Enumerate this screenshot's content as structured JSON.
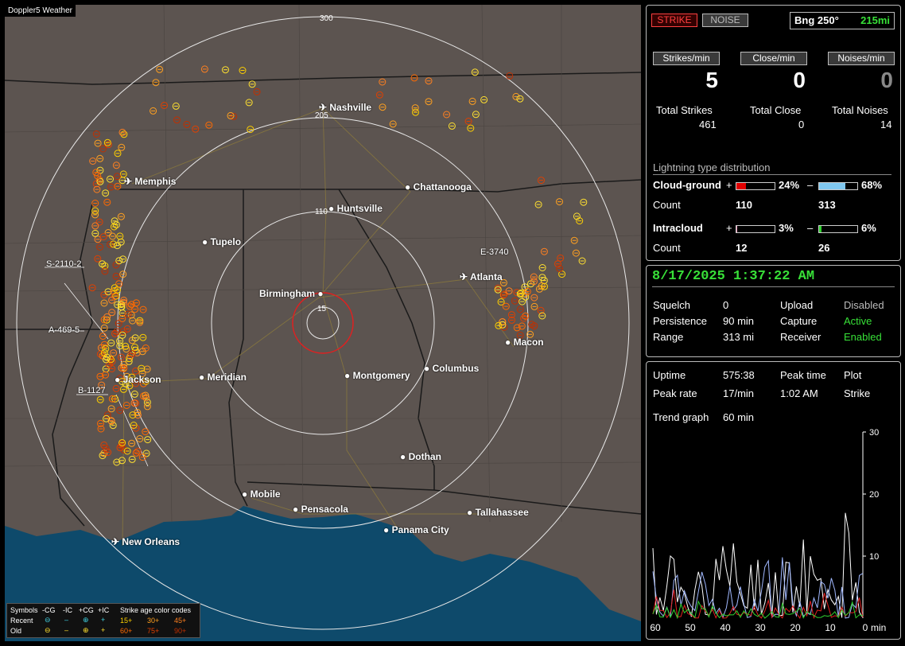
{
  "app_title": "Doppler5 Weather",
  "map": {
    "cities": [
      {
        "name": "Nashville",
        "airport": true
      },
      {
        "name": "Memphis",
        "airport": true
      },
      {
        "name": "Chattanooga",
        "airport": false
      },
      {
        "name": "Huntsville",
        "airport": false
      },
      {
        "name": "Tupelo",
        "airport": false
      },
      {
        "name": "Atlanta",
        "airport": true
      },
      {
        "name": "Birmingham",
        "airport": false
      },
      {
        "name": "Macon",
        "airport": false
      },
      {
        "name": "Jackson",
        "airport": true
      },
      {
        "name": "Meridian",
        "airport": false
      },
      {
        "name": "Montgomery",
        "airport": false
      },
      {
        "name": "Columbus",
        "airport": false
      },
      {
        "name": "Dothan",
        "airport": false
      },
      {
        "name": "Mobile",
        "airport": false
      },
      {
        "name": "Pensacola",
        "airport": false
      },
      {
        "name": "Tallahassee",
        "airport": false
      },
      {
        "name": "Panama City",
        "airport": false
      },
      {
        "name": "New Orleans",
        "airport": true
      }
    ],
    "range_labels": [
      "300",
      "205",
      "110",
      "15"
    ],
    "storm_labels": [
      "S-2110-2",
      "A-469-5",
      "B-1127",
      "E-3740"
    ]
  },
  "legend": {
    "symbols_title": "Symbols",
    "cg_neg": "-CG",
    "ic_neg": "-IC",
    "cg_pos": "+CG",
    "ic_pos": "+IC",
    "age_title": "Strike age color codes",
    "recent": "Recent",
    "old": "Old",
    "ages": [
      "15+",
      "30+",
      "45+",
      "60+",
      "75+",
      "90+"
    ],
    "age_colors": [
      "#ffd000",
      "#ffa020",
      "#ff8020",
      "#ff6a00",
      "#e04000",
      "#c03000"
    ]
  },
  "panel1": {
    "strike_btn": "STRIKE",
    "noise_btn": "NOISE",
    "bearing": "Bng 250°",
    "distance": "215mi",
    "hdr_strikes": "Strikes/min",
    "hdr_close": "Close/min",
    "hdr_noises": "Noises/min",
    "val_strikes": "5",
    "val_close": "0",
    "val_noises": "0",
    "lbl_total_strikes": "Total Strikes",
    "lbl_total_close": "Total Close",
    "lbl_total_noises": "Total Noises",
    "total_strikes": "461",
    "total_close": "0",
    "total_noises": "14",
    "dist_title": "Lightning type distribution",
    "cg_label": "Cloud-ground",
    "cg_plus": "+",
    "cg_plus_pct": "24%",
    "cg_minus": "–",
    "cg_minus_pct": "68%",
    "count_label": "Count",
    "cg_plus_count": "110",
    "cg_minus_count": "313",
    "ic_label": "Intracloud",
    "ic_plus": "+",
    "ic_plus_pct": "3%",
    "ic_minus": "–",
    "ic_minus_pct": "6%",
    "ic_plus_count": "12",
    "ic_minus_count": "26",
    "cg_plus_level": 24,
    "cg_minus_level": 68,
    "ic_plus_level": 3,
    "ic_minus_level": 6
  },
  "panel2": {
    "datetime": "8/17/2025 1:37:22 AM",
    "squelch_label": "Squelch",
    "squelch": "0",
    "upload_label": "Upload",
    "upload": "Disabled",
    "persistence_label": "Persistence",
    "persistence": "90 min",
    "capture_label": "Capture",
    "capture": "Active",
    "range_label": "Range",
    "range": "313 mi",
    "receiver_label": "Receiver",
    "receiver": "Enabled"
  },
  "panel3": {
    "uptime_label": "Uptime",
    "uptime": "575:38",
    "peak_time_label": "Peak time",
    "plot_label": "Plot",
    "peak_rate_label": "Peak rate",
    "peak_rate": "17/min",
    "peak_time": "1:02 AM",
    "plot": "Strike",
    "trend_label": "Trend graph",
    "trend_range": "60 min",
    "y_ticks": [
      "30",
      "20",
      "10"
    ],
    "x_ticks": [
      "60",
      "50",
      "40",
      "30",
      "20",
      "10",
      "0"
    ],
    "x_unit": "min"
  }
}
